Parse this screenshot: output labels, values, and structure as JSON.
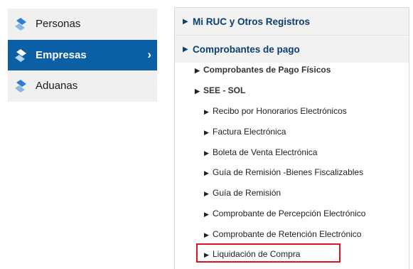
{
  "left_nav": {
    "items": [
      {
        "label": "Personas",
        "active": false
      },
      {
        "label": "Empresas",
        "active": true
      },
      {
        "label": "Aduanas",
        "active": false
      }
    ],
    "accent_color": "#0b5fa5",
    "icon": "sunat-diamond-icon"
  },
  "right_menu": {
    "sections": [
      {
        "label": "Mi RUC y Otros Registros"
      },
      {
        "label": "Comprobantes de pago"
      }
    ],
    "subsections": [
      {
        "label": "Comprobantes de Pago Físicos"
      },
      {
        "label": "SEE - SOL"
      }
    ],
    "items": [
      {
        "label": "Recibo por Honorarios Electrónicos"
      },
      {
        "label": "Factura Electrónica"
      },
      {
        "label": "Boleta de Venta Electrónica"
      },
      {
        "label": "Guía de Remisión -Bienes Fiscalizables"
      },
      {
        "label": "Guía de Remisión"
      },
      {
        "label": "Comprobante de Percepción Electrónico"
      },
      {
        "label": "Comprobante de Retención Electrónico"
      },
      {
        "label": "Liquidación de Compra",
        "highlighted": true
      }
    ],
    "highlight_color": "#e0141e"
  }
}
